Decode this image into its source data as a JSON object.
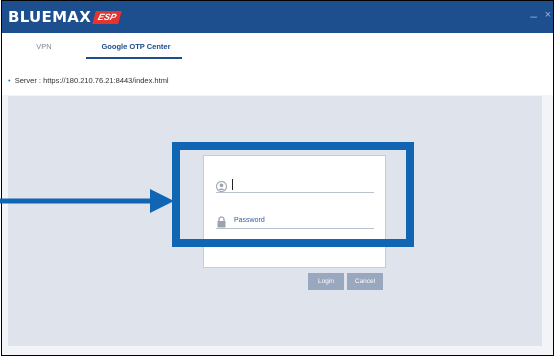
{
  "app": {
    "logo_text": "BLUEMAX",
    "logo_badge": "ESP",
    "window_controls": [
      "minimize",
      "close"
    ]
  },
  "tabs": [
    {
      "label": "VPN",
      "active": false
    },
    {
      "label": "Google OTP Center",
      "active": true
    }
  ],
  "server": {
    "label": "Server :",
    "url": "https://180.210.76.21:8443/index.html"
  },
  "login": {
    "username_value": "",
    "username_icon": "user-icon",
    "password_placeholder": "Password",
    "password_icon": "lock-icon",
    "login_label": "Login",
    "cancel_label": "Cancel"
  },
  "annotation": {
    "highlight_color": "#1166b3",
    "arrow_color": "#1166b3"
  }
}
